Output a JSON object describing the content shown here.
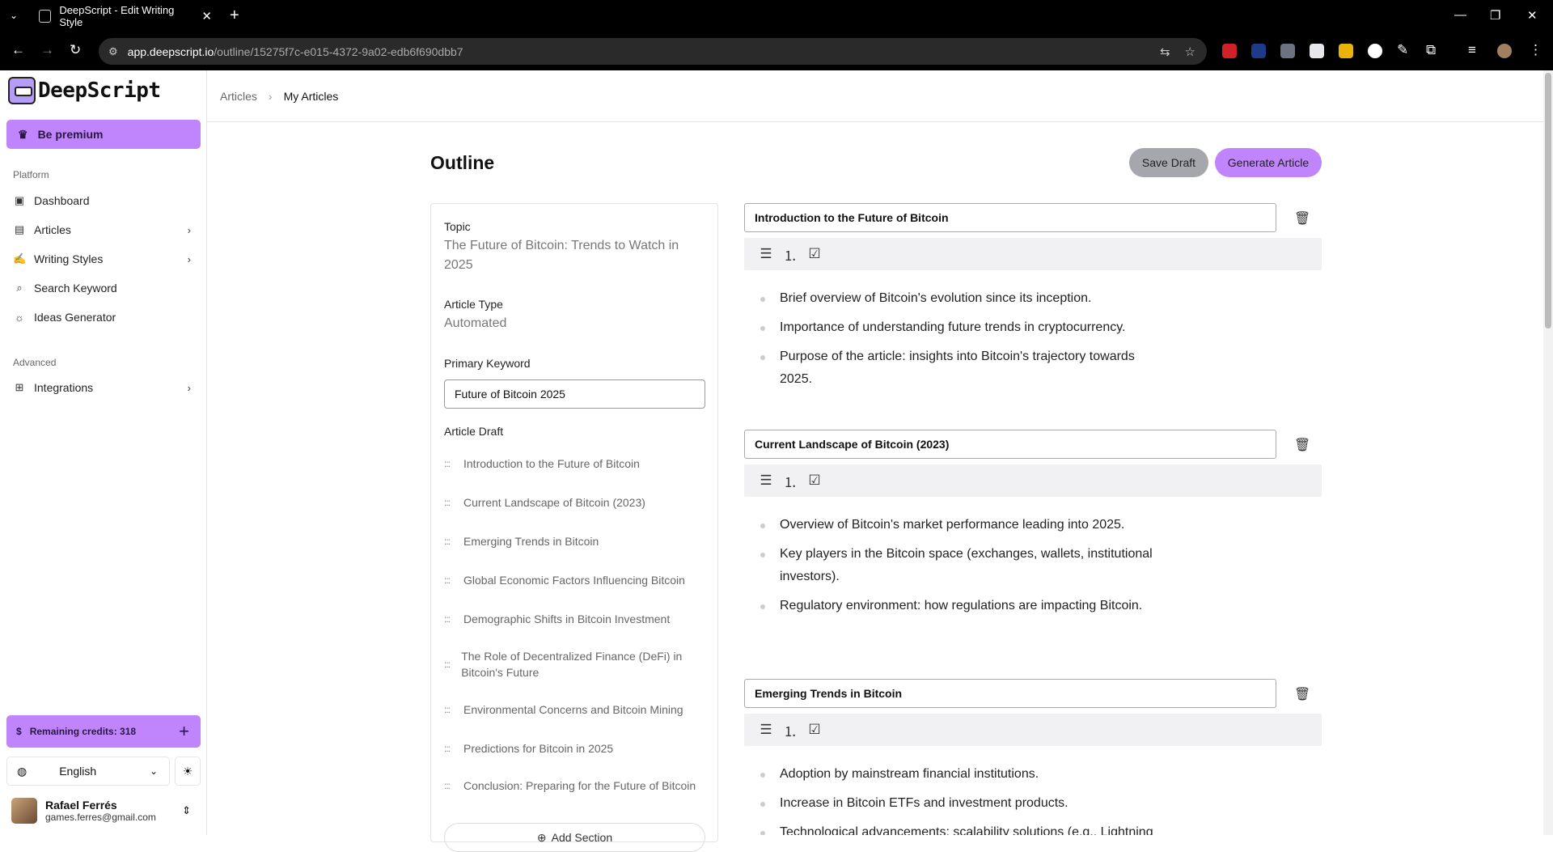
{
  "browser": {
    "tab_title": "DeepScript - Edit Writing Style",
    "tab_close": "✕",
    "new_tab": "+",
    "url_domain": "app.deepscript.io",
    "url_path": "/outline/15275f7c-e015-4372-9a02-edb6f690dbb7"
  },
  "sidebar": {
    "logo_text": "DeepScript",
    "premium_label": "Be premium",
    "platform_label": "Platform",
    "platform_items": [
      {
        "label": "Dashboard",
        "icon": "dashboard-icon",
        "has_chevron": false
      },
      {
        "label": "Articles",
        "icon": "articles-icon",
        "has_chevron": true
      },
      {
        "label": "Writing Styles",
        "icon": "writing-styles-icon",
        "has_chevron": true
      },
      {
        "label": "Search Keyword",
        "icon": "search-icon",
        "has_chevron": false
      },
      {
        "label": "Ideas Generator",
        "icon": "lightbulb-icon",
        "has_chevron": false
      }
    ],
    "advanced_label": "Advanced",
    "advanced_items": [
      {
        "label": "Integrations",
        "icon": "integrations-icon",
        "has_chevron": true
      }
    ],
    "credits_label": "Remaining credits: 318",
    "language": "English",
    "user_name": "Rafael Ferrés",
    "user_email": "games.ferres@gmail.com"
  },
  "breadcrumb": {
    "items": [
      "Articles",
      "My Articles"
    ]
  },
  "page": {
    "title": "Outline",
    "save_draft_label": "Save Draft",
    "generate_label": "Generate Article"
  },
  "panel": {
    "topic_label": "Topic",
    "topic_value": "The Future of Bitcoin: Trends to Watch in 2025",
    "type_label": "Article Type",
    "type_value": "Automated",
    "keyword_label": "Primary Keyword",
    "keyword_value": "Future of Bitcoin 2025",
    "draft_label": "Article Draft",
    "draft_items": [
      "Introduction to the Future of Bitcoin",
      "Current Landscape of Bitcoin (2023)",
      "Emerging Trends in Bitcoin",
      "Global Economic Factors Influencing Bitcoin",
      "Demographic Shifts in Bitcoin Investment",
      "The Role of Decentralized Finance (DeFi) in Bitcoin's Future",
      "Environmental Concerns and Bitcoin Mining",
      "Predictions for Bitcoin in 2025",
      "Conclusion: Preparing for the Future of Bitcoin"
    ],
    "add_section_label": "Add Section"
  },
  "sections": [
    {
      "title": "Introduction to the Future of Bitcoin",
      "bullets": [
        "Brief overview of Bitcoin's evolution since its inception.",
        "Importance of understanding future trends in cryptocurrency.",
        "Purpose of the article: insights into Bitcoin's trajectory towards 2025."
      ]
    },
    {
      "title": "Current Landscape of Bitcoin (2023)",
      "bullets": [
        "Overview of Bitcoin's market performance leading into 2025.",
        "Key players in the Bitcoin space (exchanges, wallets, institutional investors).",
        "Regulatory environment: how regulations are impacting Bitcoin."
      ]
    },
    {
      "title": "Emerging Trends in Bitcoin",
      "bullets": [
        "Adoption by mainstream financial institutions.",
        "Increase in Bitcoin ETFs and investment products.",
        "Technological advancements: scalability solutions (e.g., Lightning"
      ]
    }
  ],
  "colors": {
    "accent": "#c084fc",
    "save_draft_bg": "#a6a6ad",
    "chrome_bg": "#000000"
  }
}
